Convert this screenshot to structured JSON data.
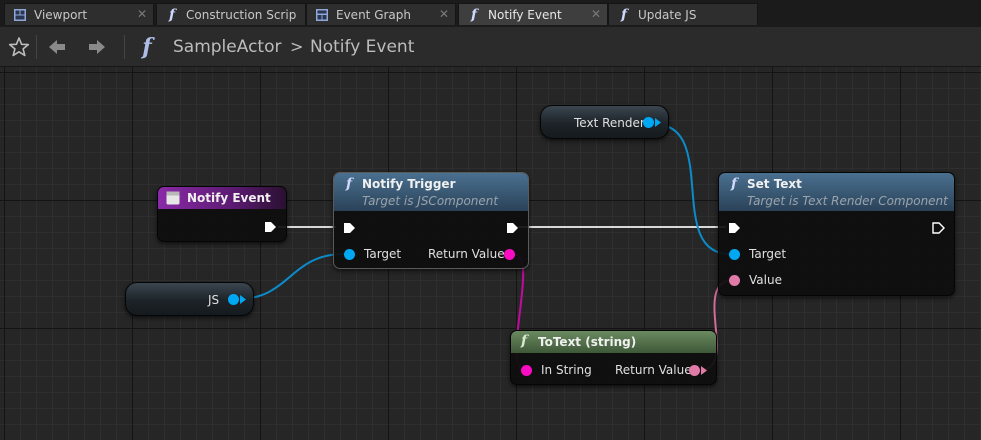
{
  "tabs": [
    {
      "label": "Viewport",
      "icon": "viewport-icon"
    },
    {
      "label": "Construction Scrip",
      "icon": "function-icon"
    },
    {
      "label": "Event Graph",
      "icon": "event-graph-icon"
    },
    {
      "label": "Notify Event",
      "icon": "function-icon",
      "active": true
    },
    {
      "label": "Update JS",
      "icon": "function-icon"
    }
  ],
  "breadcrumb": {
    "actor": "SampleActor",
    "separator": ">",
    "graph": "Notify Event"
  },
  "nodes": {
    "notify_event": {
      "title": "Notify Event"
    },
    "notify_trigger": {
      "title": "Notify Trigger",
      "subtitle": "Target is JSComponent",
      "pin_target": "Target",
      "pin_return": "Return Value"
    },
    "set_text": {
      "title": "Set Text",
      "subtitle": "Target is Text Render Component",
      "pin_target": "Target",
      "pin_value": "Value"
    },
    "to_text": {
      "title": "ToText (string)",
      "pin_in": "In String",
      "pin_return": "Return Value"
    },
    "var_text_render": {
      "label": "Text Render"
    },
    "var_js": {
      "label": "JS"
    }
  },
  "colors": {
    "object_pin": "#00a8f4",
    "string_pin": "#f90cc2",
    "text_pin": "#e07ba8",
    "event_header": "#7a1e8f",
    "function_header": "#3a5a7a",
    "pure_header": "#5a7a52"
  }
}
